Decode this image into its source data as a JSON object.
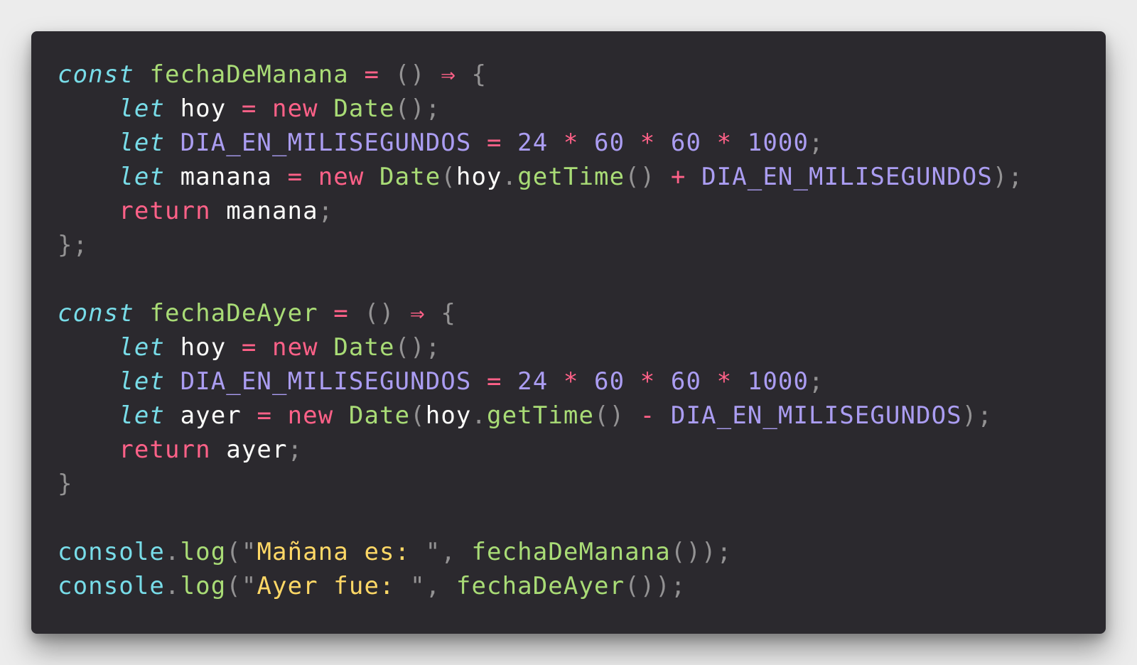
{
  "editor": {
    "language": "javascript",
    "theme_colors": {
      "background": "#2b292e",
      "page_background": "#ececec",
      "storage_keyword": "#78dce8",
      "control_keyword": "#ff6188",
      "operator": "#ff6188",
      "function_name": "#a9dc76",
      "constant": "#ab9df2",
      "number": "#ab9df2",
      "string": "#ffd866",
      "variable": "#fcfcfa",
      "punctuation": "#939293"
    },
    "lines": [
      [
        {
          "text": "const",
          "color": "#78dce8",
          "italic": true
        },
        {
          "text": " ",
          "color": "#fcfcfa"
        },
        {
          "text": "fechaDeManana",
          "color": "#a9dc76"
        },
        {
          "text": " ",
          "color": "#fcfcfa"
        },
        {
          "text": "=",
          "color": "#ff6188"
        },
        {
          "text": " ",
          "color": "#fcfcfa"
        },
        {
          "text": "()",
          "color": "#939293"
        },
        {
          "text": " ",
          "color": "#fcfcfa"
        },
        {
          "text": "⇒",
          "color": "#ff6188"
        },
        {
          "text": " ",
          "color": "#fcfcfa"
        },
        {
          "text": "{",
          "color": "#939293"
        }
      ],
      [
        {
          "text": "    ",
          "color": "#fcfcfa"
        },
        {
          "text": "let",
          "color": "#78dce8",
          "italic": true
        },
        {
          "text": " ",
          "color": "#fcfcfa"
        },
        {
          "text": "hoy",
          "color": "#fcfcfa"
        },
        {
          "text": " ",
          "color": "#fcfcfa"
        },
        {
          "text": "=",
          "color": "#ff6188"
        },
        {
          "text": " ",
          "color": "#fcfcfa"
        },
        {
          "text": "new",
          "color": "#ff6188"
        },
        {
          "text": " ",
          "color": "#fcfcfa"
        },
        {
          "text": "Date",
          "color": "#a9dc76"
        },
        {
          "text": "();",
          "color": "#939293"
        }
      ],
      [
        {
          "text": "    ",
          "color": "#fcfcfa"
        },
        {
          "text": "let",
          "color": "#78dce8",
          "italic": true
        },
        {
          "text": " ",
          "color": "#fcfcfa"
        },
        {
          "text": "DIA_EN_MILISEGUNDOS",
          "color": "#ab9df2"
        },
        {
          "text": " ",
          "color": "#fcfcfa"
        },
        {
          "text": "=",
          "color": "#ff6188"
        },
        {
          "text": " ",
          "color": "#fcfcfa"
        },
        {
          "text": "24",
          "color": "#ab9df2"
        },
        {
          "text": " ",
          "color": "#fcfcfa"
        },
        {
          "text": "*",
          "color": "#ff6188"
        },
        {
          "text": " ",
          "color": "#fcfcfa"
        },
        {
          "text": "60",
          "color": "#ab9df2"
        },
        {
          "text": " ",
          "color": "#fcfcfa"
        },
        {
          "text": "*",
          "color": "#ff6188"
        },
        {
          "text": " ",
          "color": "#fcfcfa"
        },
        {
          "text": "60",
          "color": "#ab9df2"
        },
        {
          "text": " ",
          "color": "#fcfcfa"
        },
        {
          "text": "*",
          "color": "#ff6188"
        },
        {
          "text": " ",
          "color": "#fcfcfa"
        },
        {
          "text": "1000",
          "color": "#ab9df2"
        },
        {
          "text": ";",
          "color": "#939293"
        }
      ],
      [
        {
          "text": "    ",
          "color": "#fcfcfa"
        },
        {
          "text": "let",
          "color": "#78dce8",
          "italic": true
        },
        {
          "text": " ",
          "color": "#fcfcfa"
        },
        {
          "text": "manana",
          "color": "#fcfcfa"
        },
        {
          "text": " ",
          "color": "#fcfcfa"
        },
        {
          "text": "=",
          "color": "#ff6188"
        },
        {
          "text": " ",
          "color": "#fcfcfa"
        },
        {
          "text": "new",
          "color": "#ff6188"
        },
        {
          "text": " ",
          "color": "#fcfcfa"
        },
        {
          "text": "Date",
          "color": "#a9dc76"
        },
        {
          "text": "(",
          "color": "#939293"
        },
        {
          "text": "hoy",
          "color": "#fcfcfa"
        },
        {
          "text": ".",
          "color": "#939293"
        },
        {
          "text": "getTime",
          "color": "#a9dc76"
        },
        {
          "text": "()",
          "color": "#939293"
        },
        {
          "text": " ",
          "color": "#fcfcfa"
        },
        {
          "text": "+",
          "color": "#ff6188"
        },
        {
          "text": " ",
          "color": "#fcfcfa"
        },
        {
          "text": "DIA_EN_MILISEGUNDOS",
          "color": "#ab9df2"
        },
        {
          "text": ");",
          "color": "#939293"
        }
      ],
      [
        {
          "text": "    ",
          "color": "#fcfcfa"
        },
        {
          "text": "return",
          "color": "#ff6188"
        },
        {
          "text": " ",
          "color": "#fcfcfa"
        },
        {
          "text": "manana",
          "color": "#fcfcfa"
        },
        {
          "text": ";",
          "color": "#939293"
        }
      ],
      [
        {
          "text": "};",
          "color": "#939293"
        }
      ],
      [],
      [
        {
          "text": "const",
          "color": "#78dce8",
          "italic": true
        },
        {
          "text": " ",
          "color": "#fcfcfa"
        },
        {
          "text": "fechaDeAyer",
          "color": "#a9dc76"
        },
        {
          "text": " ",
          "color": "#fcfcfa"
        },
        {
          "text": "=",
          "color": "#ff6188"
        },
        {
          "text": " ",
          "color": "#fcfcfa"
        },
        {
          "text": "()",
          "color": "#939293"
        },
        {
          "text": " ",
          "color": "#fcfcfa"
        },
        {
          "text": "⇒",
          "color": "#ff6188"
        },
        {
          "text": " ",
          "color": "#fcfcfa"
        },
        {
          "text": "{",
          "color": "#939293"
        }
      ],
      [
        {
          "text": "    ",
          "color": "#fcfcfa"
        },
        {
          "text": "let",
          "color": "#78dce8",
          "italic": true
        },
        {
          "text": " ",
          "color": "#fcfcfa"
        },
        {
          "text": "hoy",
          "color": "#fcfcfa"
        },
        {
          "text": " ",
          "color": "#fcfcfa"
        },
        {
          "text": "=",
          "color": "#ff6188"
        },
        {
          "text": " ",
          "color": "#fcfcfa"
        },
        {
          "text": "new",
          "color": "#ff6188"
        },
        {
          "text": " ",
          "color": "#fcfcfa"
        },
        {
          "text": "Date",
          "color": "#a9dc76"
        },
        {
          "text": "();",
          "color": "#939293"
        }
      ],
      [
        {
          "text": "    ",
          "color": "#fcfcfa"
        },
        {
          "text": "let",
          "color": "#78dce8",
          "italic": true
        },
        {
          "text": " ",
          "color": "#fcfcfa"
        },
        {
          "text": "DIA_EN_MILISEGUNDOS",
          "color": "#ab9df2"
        },
        {
          "text": " ",
          "color": "#fcfcfa"
        },
        {
          "text": "=",
          "color": "#ff6188"
        },
        {
          "text": " ",
          "color": "#fcfcfa"
        },
        {
          "text": "24",
          "color": "#ab9df2"
        },
        {
          "text": " ",
          "color": "#fcfcfa"
        },
        {
          "text": "*",
          "color": "#ff6188"
        },
        {
          "text": " ",
          "color": "#fcfcfa"
        },
        {
          "text": "60",
          "color": "#ab9df2"
        },
        {
          "text": " ",
          "color": "#fcfcfa"
        },
        {
          "text": "*",
          "color": "#ff6188"
        },
        {
          "text": " ",
          "color": "#fcfcfa"
        },
        {
          "text": "60",
          "color": "#ab9df2"
        },
        {
          "text": " ",
          "color": "#fcfcfa"
        },
        {
          "text": "*",
          "color": "#ff6188"
        },
        {
          "text": " ",
          "color": "#fcfcfa"
        },
        {
          "text": "1000",
          "color": "#ab9df2"
        },
        {
          "text": ";",
          "color": "#939293"
        }
      ],
      [
        {
          "text": "    ",
          "color": "#fcfcfa"
        },
        {
          "text": "let",
          "color": "#78dce8",
          "italic": true
        },
        {
          "text": " ",
          "color": "#fcfcfa"
        },
        {
          "text": "ayer",
          "color": "#fcfcfa"
        },
        {
          "text": " ",
          "color": "#fcfcfa"
        },
        {
          "text": "=",
          "color": "#ff6188"
        },
        {
          "text": " ",
          "color": "#fcfcfa"
        },
        {
          "text": "new",
          "color": "#ff6188"
        },
        {
          "text": " ",
          "color": "#fcfcfa"
        },
        {
          "text": "Date",
          "color": "#a9dc76"
        },
        {
          "text": "(",
          "color": "#939293"
        },
        {
          "text": "hoy",
          "color": "#fcfcfa"
        },
        {
          "text": ".",
          "color": "#939293"
        },
        {
          "text": "getTime",
          "color": "#a9dc76"
        },
        {
          "text": "()",
          "color": "#939293"
        },
        {
          "text": " ",
          "color": "#fcfcfa"
        },
        {
          "text": "-",
          "color": "#ff6188"
        },
        {
          "text": " ",
          "color": "#fcfcfa"
        },
        {
          "text": "DIA_EN_MILISEGUNDOS",
          "color": "#ab9df2"
        },
        {
          "text": ");",
          "color": "#939293"
        }
      ],
      [
        {
          "text": "    ",
          "color": "#fcfcfa"
        },
        {
          "text": "return",
          "color": "#ff6188"
        },
        {
          "text": " ",
          "color": "#fcfcfa"
        },
        {
          "text": "ayer",
          "color": "#fcfcfa"
        },
        {
          "text": ";",
          "color": "#939293"
        }
      ],
      [
        {
          "text": "}",
          "color": "#939293"
        }
      ],
      [],
      [
        {
          "text": "console",
          "color": "#78dce8"
        },
        {
          "text": ".",
          "color": "#939293"
        },
        {
          "text": "log",
          "color": "#a9dc76"
        },
        {
          "text": "(",
          "color": "#939293"
        },
        {
          "text": "\"",
          "color": "#939293"
        },
        {
          "text": "Mañana es: ",
          "color": "#ffd866"
        },
        {
          "text": "\"",
          "color": "#939293"
        },
        {
          "text": ",",
          "color": "#939293"
        },
        {
          "text": " ",
          "color": "#fcfcfa"
        },
        {
          "text": "fechaDeManana",
          "color": "#a9dc76"
        },
        {
          "text": "());",
          "color": "#939293"
        }
      ],
      [
        {
          "text": "console",
          "color": "#78dce8"
        },
        {
          "text": ".",
          "color": "#939293"
        },
        {
          "text": "log",
          "color": "#a9dc76"
        },
        {
          "text": "(",
          "color": "#939293"
        },
        {
          "text": "\"",
          "color": "#939293"
        },
        {
          "text": "Ayer fue: ",
          "color": "#ffd866"
        },
        {
          "text": "\"",
          "color": "#939293"
        },
        {
          "text": ",",
          "color": "#939293"
        },
        {
          "text": " ",
          "color": "#fcfcfa"
        },
        {
          "text": "fechaDeAyer",
          "color": "#a9dc76"
        },
        {
          "text": "());",
          "color": "#939293"
        }
      ]
    ]
  }
}
